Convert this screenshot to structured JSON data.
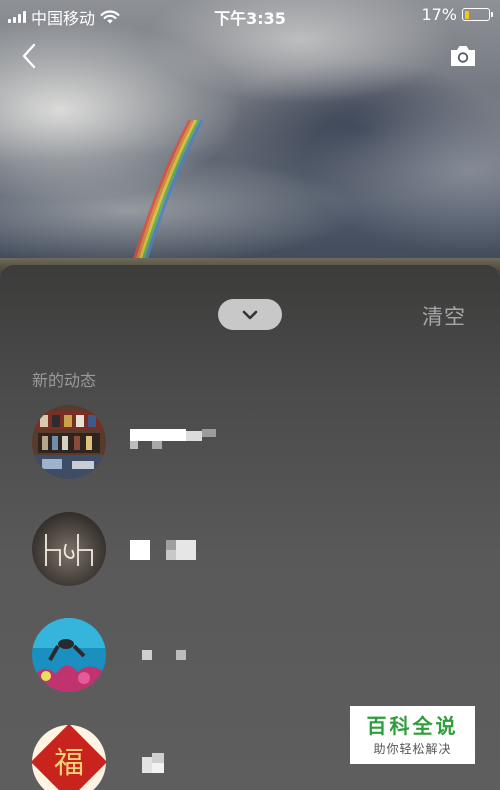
{
  "status_bar": {
    "carrier": "中国移动",
    "time": "下午3:35",
    "battery_percent": "17%",
    "battery_level": 0.17,
    "icons": [
      "signal-icon",
      "wifi-icon",
      "battery-icon"
    ]
  },
  "nav": {
    "back_icon": "chevron-left-icon",
    "camera_icon": "camera-icon"
  },
  "sheet": {
    "collapse_icon": "chevron-down-icon",
    "clear_label": "清空",
    "section_title": "新的动态",
    "items": [
      {
        "avatar": "bookshop-photo",
        "name": ""
      },
      {
        "avatar": "neon-sign-photo",
        "name": ""
      },
      {
        "avatar": "diver-photo",
        "name": ""
      },
      {
        "avatar": "fu-character-photo",
        "name": "",
        "avatar_text": "福"
      }
    ]
  },
  "watermark": {
    "title": "百科全说",
    "subtitle": "助你轻松解决"
  },
  "colors": {
    "accent_green": "#2e9e3a",
    "battery_fill": "#f5c518",
    "sheet_bg": "#4a4a4a"
  }
}
